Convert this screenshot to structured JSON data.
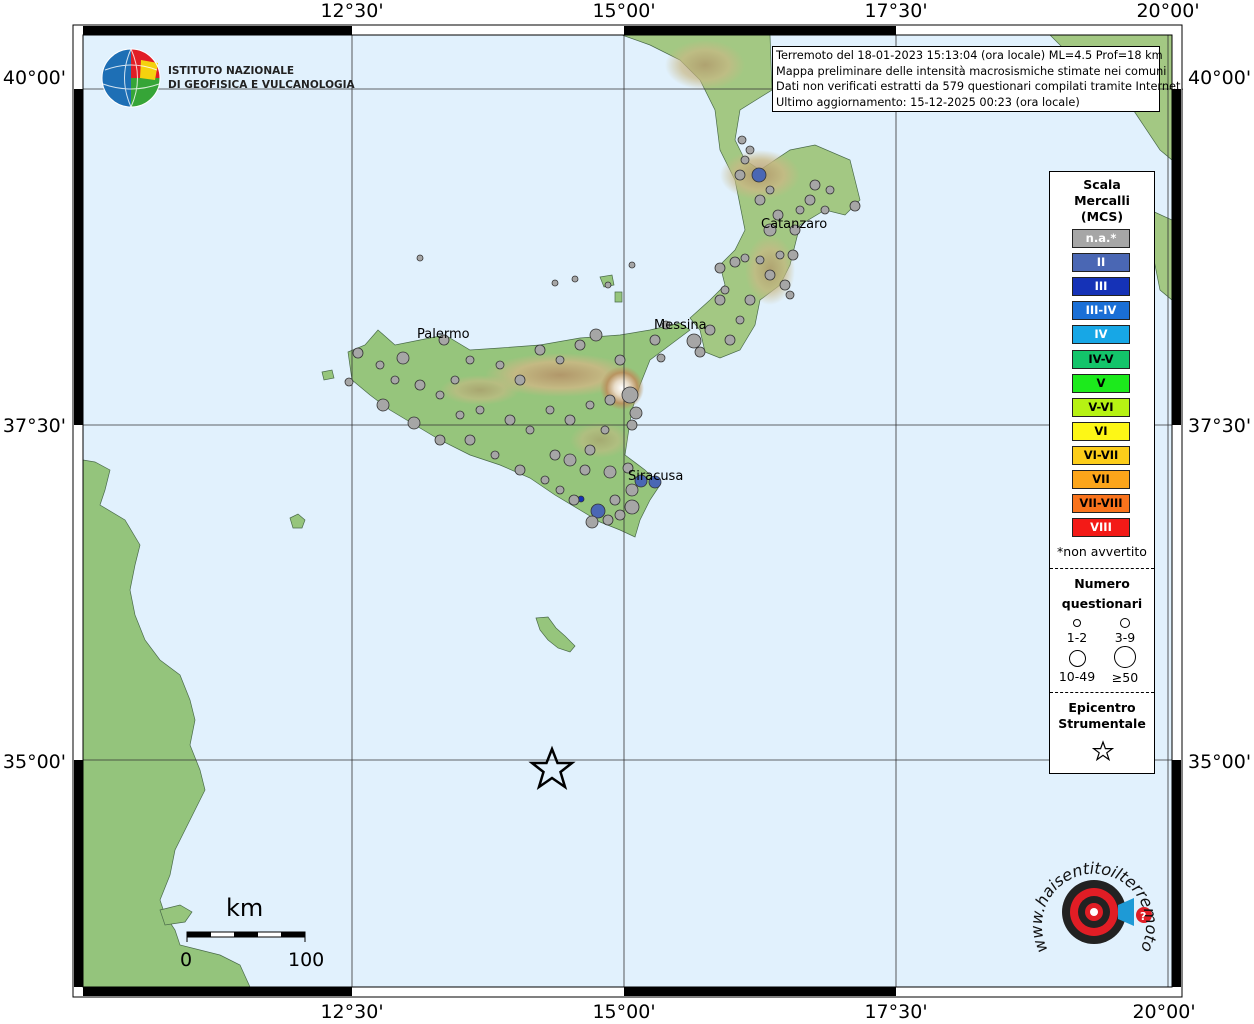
{
  "map": {
    "top_lon_labels": [
      "12°30'",
      "15°00'",
      "17°30'",
      "20°00'"
    ],
    "bottom_lon_labels": [
      "12°30'",
      "15°00'",
      "17°30'",
      "20°00'"
    ],
    "left_lat_labels": [
      "40°00'",
      "37°30'",
      "35°00'"
    ],
    "right_lat_labels": [
      "40°00'",
      "37°30'",
      "35°00'"
    ],
    "cities": [
      "Palermo",
      "Messina",
      "Catanzaro",
      "Siracusa"
    ],
    "colors": {
      "sea": "#e1f1fd",
      "land_low": "#93c57a",
      "land_mid": "#cfc48a",
      "land_high": "#a98a5e"
    }
  },
  "logo": {
    "line1": "ISTITUTO NAZIONALE",
    "line2": "DI GEOFISICA E VULCANOLOGIA"
  },
  "info": {
    "line1": "Terremoto del 18-01-2023 15:13:04 (ora locale) ML=4.5 Prof=18 km",
    "line2": "Mappa preliminare delle intensità macrosismiche stimate nei comuni",
    "line3": "Dati non verificati estratti da 579 questionari compilati tramite Internet.",
    "line4": "Ultimo aggiornamento: 15-12-2025 00:23 (ora locale)"
  },
  "legend": {
    "title1": "Scala",
    "title2": "Mercalli",
    "title3": "(MCS)",
    "scale": [
      {
        "label": "n.a.*",
        "color": "#a6a6a6",
        "text": "#ffffff"
      },
      {
        "label": "II",
        "color": "#4a67b4",
        "text": "#ffffff"
      },
      {
        "label": "III",
        "color": "#1532b7",
        "text": "#ffffff"
      },
      {
        "label": "III-IV",
        "color": "#1a6fd6",
        "text": "#ffffff"
      },
      {
        "label": "IV",
        "color": "#17a7e6",
        "text": "#ffffff"
      },
      {
        "label": "IV-V",
        "color": "#13c46a",
        "text": "#000000"
      },
      {
        "label": "V",
        "color": "#1cea1c",
        "text": "#000000"
      },
      {
        "label": "V-VI",
        "color": "#b6f213",
        "text": "#000000"
      },
      {
        "label": "VI",
        "color": "#fdf716",
        "text": "#000000"
      },
      {
        "label": "VI-VII",
        "color": "#fccd1a",
        "text": "#000000"
      },
      {
        "label": "VII",
        "color": "#fca51a",
        "text": "#000000"
      },
      {
        "label": "VII-VIII",
        "color": "#f9731c",
        "text": "#000000"
      },
      {
        "label": "VIII",
        "color": "#f31a17",
        "text": "#ffffff"
      }
    ],
    "na_note": "*non avvertito",
    "count_title1": "Numero",
    "count_title2": "questionari",
    "count_classes": [
      "1-2",
      "3-9",
      "10-49",
      "≥50"
    ],
    "epi_title1": "Epicentro",
    "epi_title2": "Strumentale"
  },
  "scalebar": {
    "unit": "km",
    "min": "0",
    "max": "100"
  },
  "badge": {
    "text": "www.haisentitoilterremoto.it"
  },
  "epicenter": {
    "lat": 34.95,
    "lon": 14.28
  }
}
